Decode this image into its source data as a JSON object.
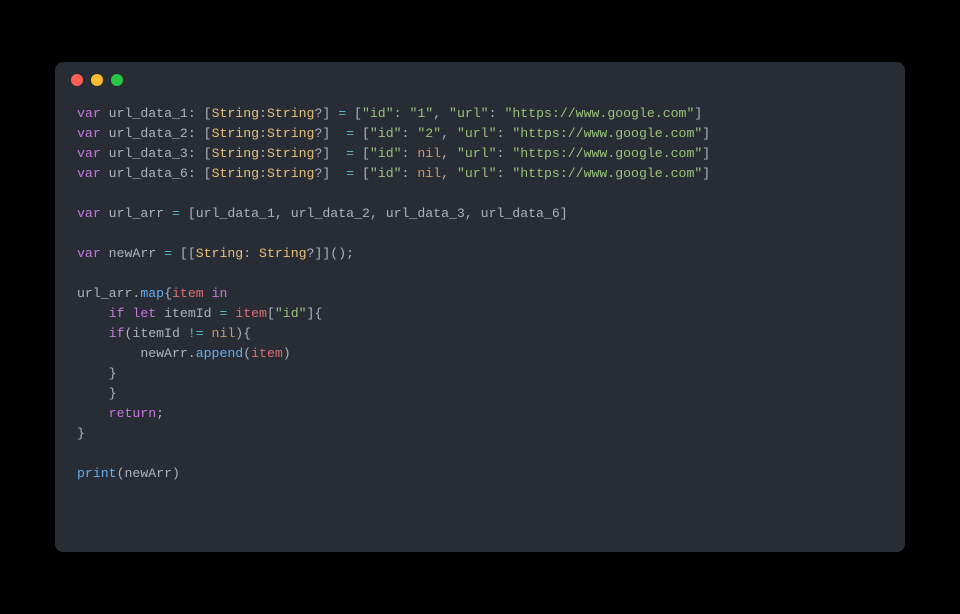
{
  "window_controls": [
    "close",
    "minimize",
    "zoom"
  ],
  "kw_var": "var",
  "kw_if": "if",
  "kw_let": "let",
  "kw_in": "in",
  "kw_return": "return",
  "decl1_name": "url_data_1",
  "decl2_name": "url_data_2",
  "decl3_name": "url_data_3",
  "decl4_name": "url_data_6",
  "type_dict_open": "[",
  "type_String": "String",
  "type_colon": ":",
  "type_opt": "?",
  "type_dict_close": "]",
  "eq": " = ",
  "eq2": "  = ",
  "br_open": "[",
  "br_close": "]",
  "key_id": "\"id\"",
  "key_url": "\"url\"",
  "val_1": "\"1\"",
  "val_2": "\"2\"",
  "nil": "nil",
  "url_val": "\"https://www.google.com\"",
  "comma": ", ",
  "colon": ": ",
  "arr_name": "url_arr",
  "arr_eq": " = ",
  "arr_open": "[",
  "arr_close": "]",
  "arr_i1": "url_data_1",
  "arr_i2": "url_data_2",
  "arr_i3": "url_data_3",
  "arr_i4": "url_data_6",
  "newArr_name": "newArr",
  "newArr_eq": " = ",
  "newArr_type_open": "[[",
  "newArr_type_close": "]]",
  "newArr_parens": "();",
  "map_target": "url_arr",
  "map_dot": ".",
  "map_fn": "map",
  "map_brace_open": "{",
  "map_item": "item",
  "map_space": " ",
  "if_open": "(",
  "if_close": ")",
  "brace_open": "{",
  "brace_close": "}",
  "itemId": "itemId",
  "assign": " = ",
  "item_sub_open": "[",
  "item_sub_close": "]",
  "neq": " != ",
  "append_target": "newArr",
  "append_dot": ".",
  "append_fn": "append",
  "append_open": "(",
  "append_arg": "item",
  "append_close": ")",
  "return_semi": ";",
  "print_fn": "print",
  "print_open": "(",
  "print_arg": "newArr",
  "print_close": ")",
  "indent1": "    ",
  "indent2": "        "
}
